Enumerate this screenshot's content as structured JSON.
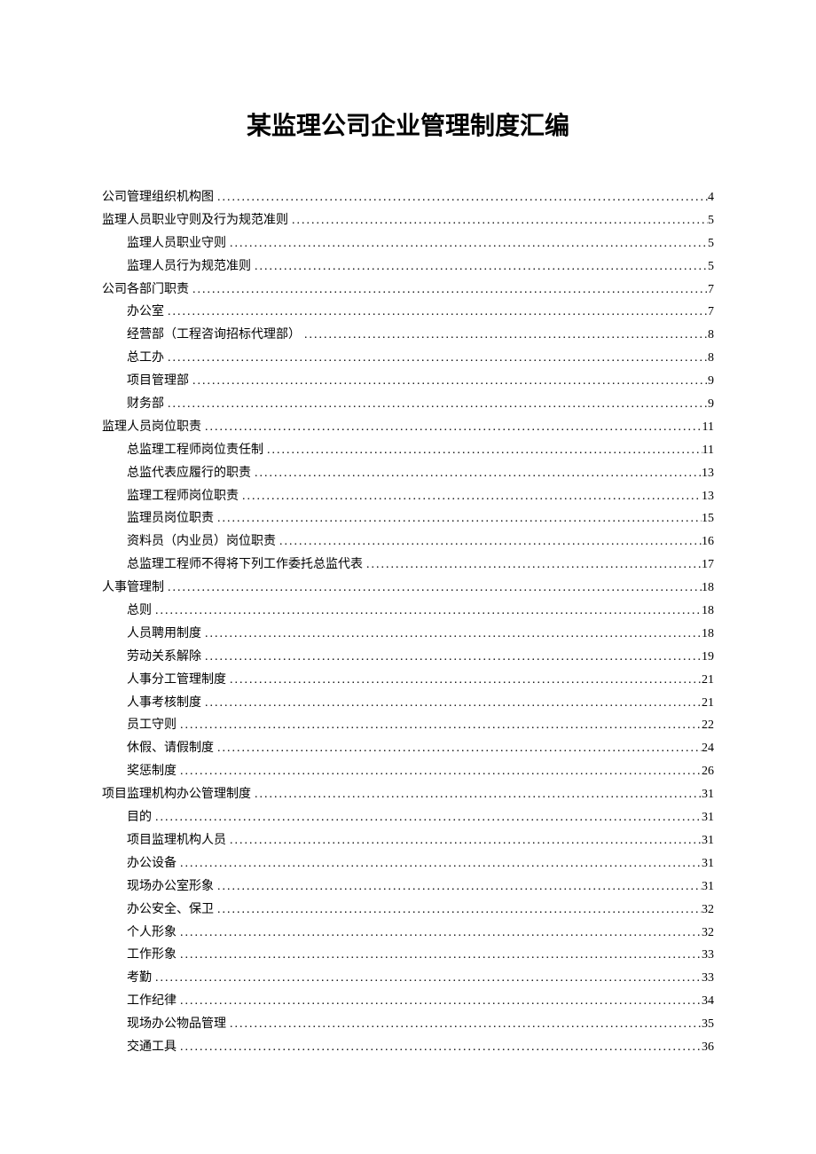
{
  "title": "某监理公司企业管理制度汇编",
  "toc": [
    {
      "level": 1,
      "text": "公司管理组织机构图",
      "page": "4"
    },
    {
      "level": 1,
      "text": "监理人员职业守则及行为规范准则",
      "page": "5"
    },
    {
      "level": 2,
      "text": "监理人员职业守则",
      "page": "5"
    },
    {
      "level": 2,
      "text": "监理人员行为规范准则",
      "page": "5"
    },
    {
      "level": 1,
      "text": "公司各部门职责",
      "page": "7"
    },
    {
      "level": 2,
      "text": "办公室",
      "page": "7"
    },
    {
      "level": 2,
      "text": "经营部（工程咨询招标代理部）",
      "page": "8"
    },
    {
      "level": 2,
      "text": "总工办",
      "page": "8"
    },
    {
      "level": 2,
      "text": "项目管理部",
      "page": "9"
    },
    {
      "level": 2,
      "text": "财务部",
      "page": "9"
    },
    {
      "level": 1,
      "text": "监理人员岗位职责",
      "page": "11"
    },
    {
      "level": 2,
      "text": "总监理工程师岗位责任制",
      "page": "11"
    },
    {
      "level": 2,
      "text": "总监代表应履行的职责",
      "page": "13"
    },
    {
      "level": 2,
      "text": "监理工程师岗位职责",
      "page": "13"
    },
    {
      "level": 2,
      "text": "监理员岗位职责",
      "page": "15"
    },
    {
      "level": 2,
      "text": "资料员（内业员）岗位职责",
      "page": "16"
    },
    {
      "level": 2,
      "text": "总监理工程师不得将下列工作委托总监代表",
      "page": "17"
    },
    {
      "level": 1,
      "text": "人事管理制",
      "page": "18"
    },
    {
      "level": 2,
      "text": "总则",
      "page": "18"
    },
    {
      "level": 2,
      "text": "人员聘用制度",
      "page": "18"
    },
    {
      "level": 2,
      "text": "劳动关系解除",
      "page": "19"
    },
    {
      "level": 2,
      "text": "人事分工管理制度",
      "page": "21"
    },
    {
      "level": 2,
      "text": "人事考核制度",
      "page": "21"
    },
    {
      "level": 2,
      "text": "员工守则",
      "page": "22"
    },
    {
      "level": 2,
      "text": "休假、请假制度",
      "page": "24"
    },
    {
      "level": 2,
      "text": "奖惩制度",
      "page": "26"
    },
    {
      "level": 1,
      "text": "项目监理机构办公管理制度",
      "page": "31"
    },
    {
      "level": 2,
      "text": "目的",
      "page": "31"
    },
    {
      "level": 2,
      "text": "项目监理机构人员",
      "page": "31"
    },
    {
      "level": 2,
      "text": "办公设备",
      "page": "31"
    },
    {
      "level": 2,
      "text": "现场办公室形象",
      "page": "31"
    },
    {
      "level": 2,
      "text": "办公安全、保卫",
      "page": "32"
    },
    {
      "level": 2,
      "text": "个人形象",
      "page": "32"
    },
    {
      "level": 2,
      "text": "工作形象",
      "page": "33"
    },
    {
      "level": 2,
      "text": "考勤",
      "page": "33"
    },
    {
      "level": 2,
      "text": "工作纪律",
      "page": "34"
    },
    {
      "level": 2,
      "text": "现场办公物品管理",
      "page": "35"
    },
    {
      "level": 2,
      "text": "交通工具",
      "page": "36"
    }
  ]
}
